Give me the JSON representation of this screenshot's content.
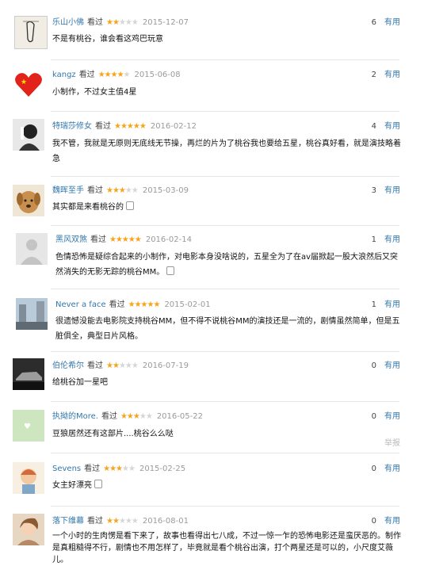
{
  "seen_label": "看过",
  "useful_label": "有用",
  "report_label": "举报",
  "colors": {
    "link": "#3377aa",
    "star_on": "#f7a41b",
    "star_off": "#d6d6d6",
    "date": "#9a9a9a"
  },
  "reviews": [
    {
      "user": "乐山小佛",
      "stars": 2,
      "date": "2015-12-07",
      "votes": "6",
      "text": "不是有桃谷，谁会看这鸡巴玩意",
      "avatar_icon": "sketch-avatar"
    },
    {
      "user": "kangz",
      "stars": 4,
      "date": "2015-06-08",
      "votes": "2",
      "text": "小制作，不过女主值4星",
      "avatar_icon": "china-flag-heart-avatar"
    },
    {
      "user": "特瑞莎修女",
      "stars": 5,
      "date": "2016-02-12",
      "votes": "4",
      "text": "我不管，我就是无原则无底线无节操，再烂的片为了桃谷我也要给五星，桃谷真好看，就是演技略着急",
      "avatar_icon": "bw-woman-avatar"
    },
    {
      "user": "魏晖至手",
      "stars": 3,
      "date": "2015-03-09",
      "votes": "3",
      "text": "其实都是来看桃谷的",
      "avatar_icon": "puppy-avatar"
    },
    {
      "user": "黑风双煞",
      "stars": 5,
      "date": "2016-02-14",
      "votes": "1",
      "text": "色情恐怖是疑综合起来的小制作，对电影本身没啥说的，五星全为了在av届掀起一股大浪然后又突然消失的无影无踪的桃谷MM。",
      "avatar_icon": "default-user-avatar"
    },
    {
      "user": "Never a face",
      "stars": 5,
      "date": "2015-02-01",
      "votes": "1",
      "text": "很遗憾没能去电影院支持桃谷MM，但不得不说桃谷MM的演技还是一流的，剧情虽然简单，但是五脏俱全，典型日片风格。",
      "avatar_icon": "street-photo-avatar"
    },
    {
      "user": "伯伦希尔",
      "stars": 2,
      "date": "2016-07-19",
      "votes": "0",
      "text": "给桃谷加一星吧",
      "avatar_icon": "car-avatar"
    },
    {
      "user": "执拗的More.",
      "stars": 3,
      "date": "2016-05-22",
      "votes": "0",
      "text": "豆狼居然还有这部片....桃谷么么哒",
      "avatar_icon": "green-card-avatar"
    },
    {
      "user": "Sevens",
      "stars": 3,
      "date": "2015-02-25",
      "votes": "0",
      "text": "女主好漂亮",
      "avatar_icon": "cartoon-avatar"
    },
    {
      "user": "落下维幕",
      "stars": 2,
      "date": "2016-08-01",
      "votes": "0",
      "text": "一个小时的生肉愣是看下来了，故事也看得出七八成，不过一惊一乍的恐怖电影还是蛮厌恶的。制作是真粗糙得不行，剧情也不用怎样了，毕竟就是看个桃谷出演，打个两星还是可以的，小尺度艾薇儿。",
      "avatar_icon": "anime-avatar"
    }
  ]
}
